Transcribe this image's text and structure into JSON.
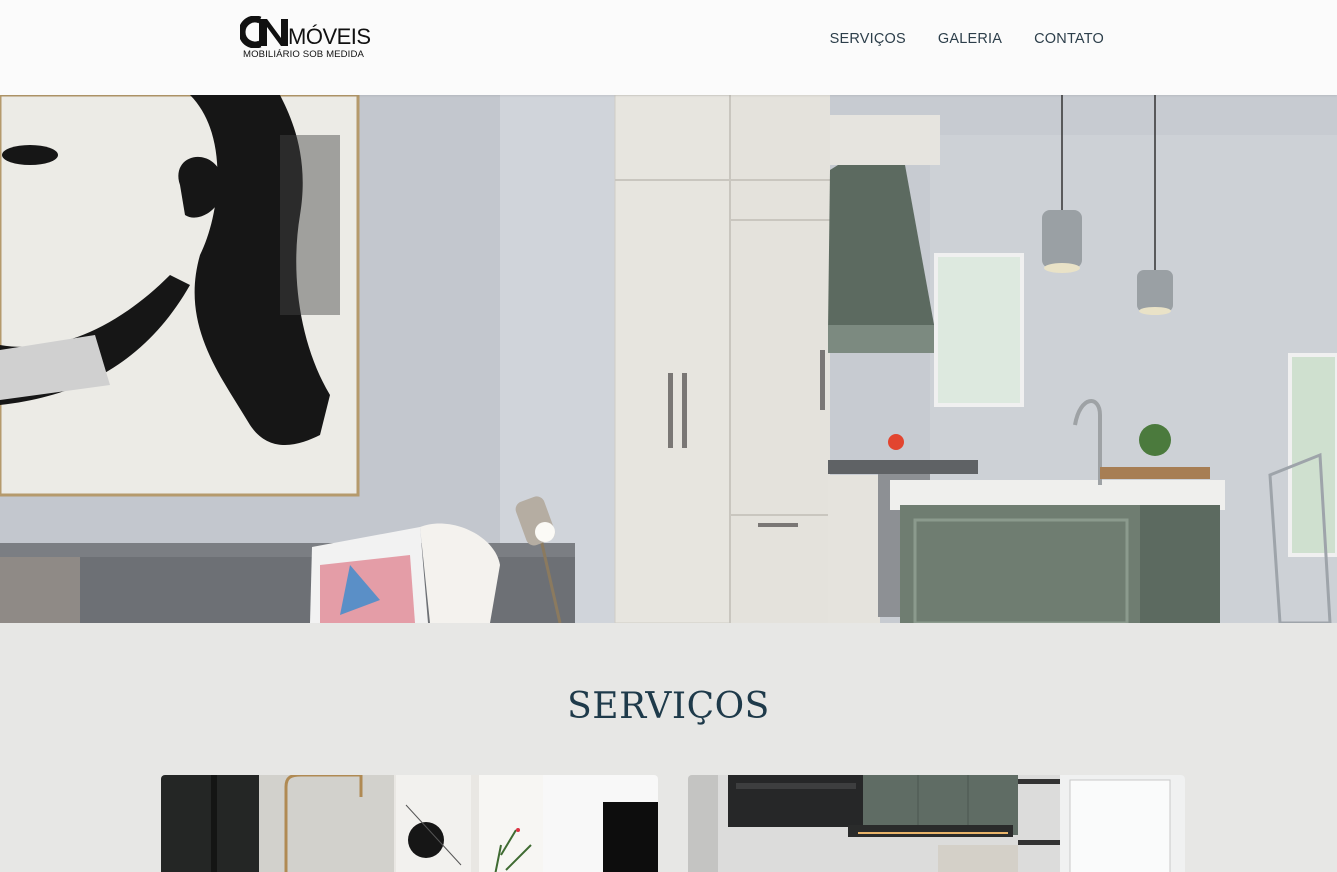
{
  "brand": {
    "logo_mark": "CN",
    "logo_word": "MÓVEIS",
    "tagline": "MOBILIÁRIO SOB MEDIDA"
  },
  "nav": {
    "items": [
      {
        "label": "SERVIÇOS"
      },
      {
        "label": "GALERIA"
      },
      {
        "label": "CONTATO"
      }
    ]
  },
  "services": {
    "title": "SERVIÇOS"
  },
  "colors": {
    "header_bg": "#fbfbfb",
    "page_bg": "#e7e7e5",
    "nav_text": "#2c3e4a",
    "title_text": "#1e3a4a"
  }
}
